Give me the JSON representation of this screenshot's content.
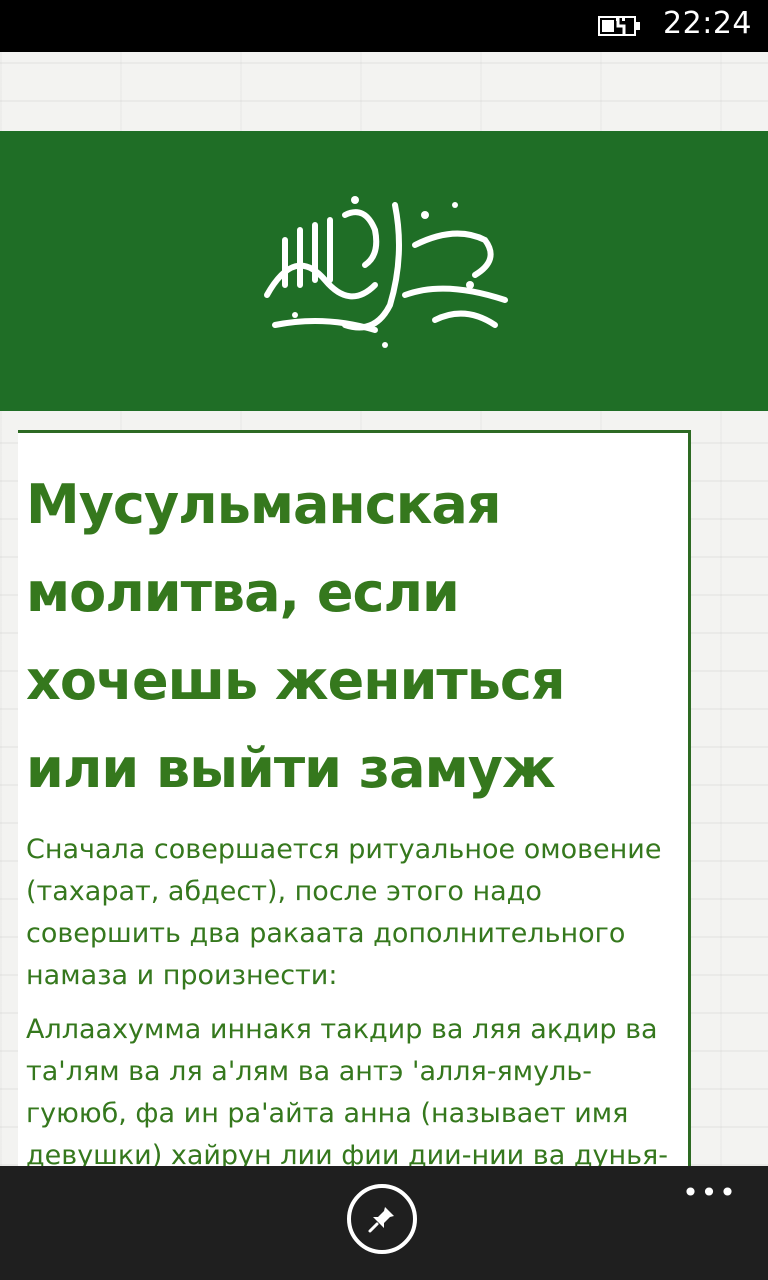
{
  "status_bar": {
    "time": "22:24",
    "battery_icon": "battery-charging-icon"
  },
  "banner": {
    "icon": "arabic-calligraphy-icon",
    "color": "#1f6e26"
  },
  "article": {
    "title": "Мусульманская молитва, если хочешь жениться или выйти замуж",
    "paragraphs": [
      "Сначала совершается ритуальное омовение (тахарат, абдест), после этого надо совершить два ракаата дополнительного намаза и произнести:",
      "Аллаахумма иннакя такдир ва ляя акдир ва та'лям ва ля а'лям ва антэ 'алля-ямуль-гуююб, фа ин ра'айта анна (называет имя девушки) хайрун лии фии дии-нии ва дунья-я ва захыратии фа-кдурхаа ли, ва ин"
    ],
    "accent_color": "#35781d"
  },
  "app_bar": {
    "pin_icon": "pin-icon",
    "more_label": "•••"
  }
}
